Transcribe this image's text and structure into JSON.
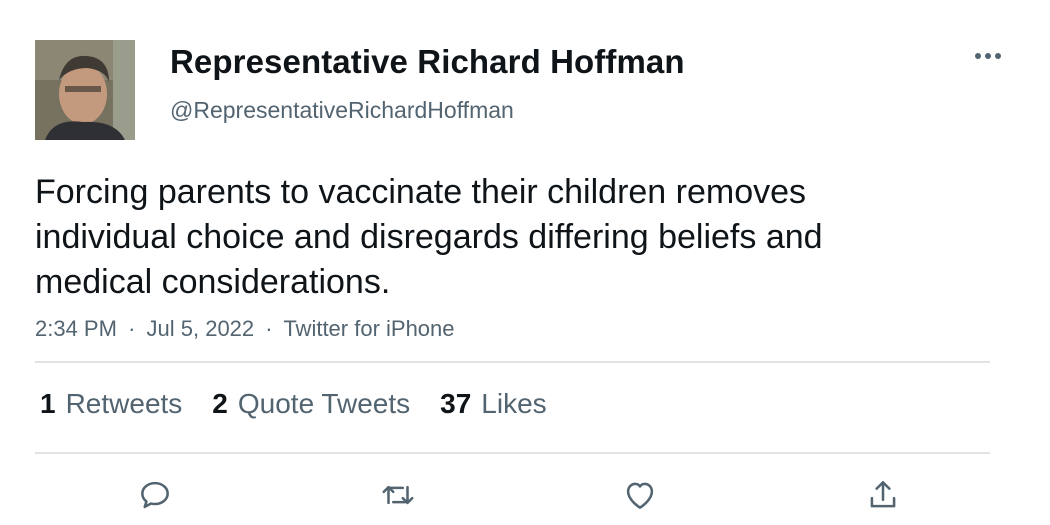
{
  "author": {
    "display_name": "Representative Richard Hoffman",
    "handle": "@RepresentativeRichardHoffman"
  },
  "tweet": {
    "text": "Forcing parents to vaccinate their children removes individual choice and disregards differing beliefs and medical considerations.",
    "time": "2:34 PM",
    "date": "Jul 5, 2022",
    "source": "Twitter for iPhone",
    "separator": "·"
  },
  "stats": {
    "retweets": {
      "count": "1",
      "label": "Retweets"
    },
    "quote_tweets": {
      "count": "2",
      "label": "Quote Tweets"
    },
    "likes": {
      "count": "37",
      "label": "Likes"
    }
  },
  "icons": {
    "more": "more-dots-icon",
    "reply": "reply-icon",
    "retweet": "retweet-icon",
    "like": "heart-icon",
    "share": "share-icon"
  },
  "colors": {
    "text_primary": "#0f1419",
    "text_secondary": "#536471",
    "divider": "#e1e3e6"
  }
}
